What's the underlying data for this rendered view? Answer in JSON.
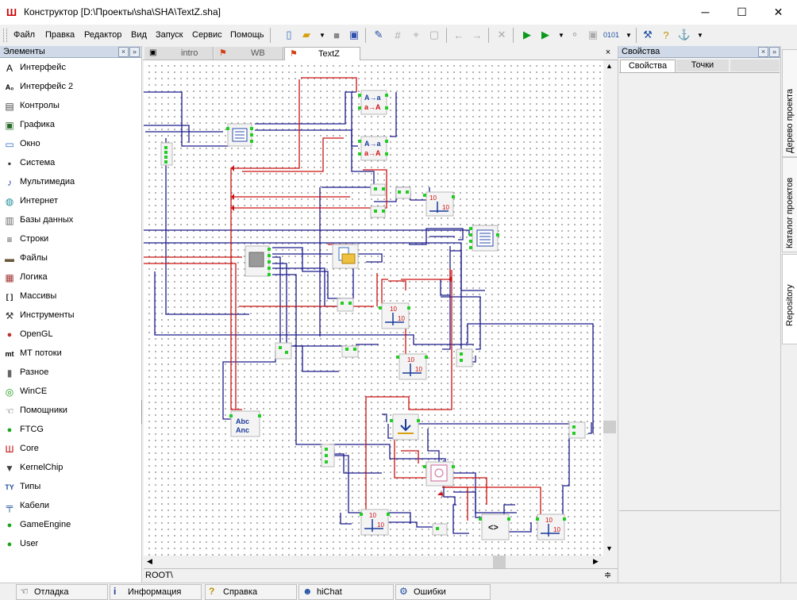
{
  "window": {
    "title": "Конструктор [D:\\Проекты\\sha\\SHA\\TextZ.sha]",
    "minimize_glyph": "─",
    "maximize_glyph": "☐",
    "close_glyph": "✕"
  },
  "menu": {
    "file": "Файл",
    "edit": "Правка",
    "editor": "Редактор",
    "view": "Вид",
    "run": "Запуск",
    "service": "Сервис",
    "help": "Помощь"
  },
  "elements_panel": {
    "title": "Элементы",
    "items": [
      {
        "label": "Интерфейс",
        "icon": "A"
      },
      {
        "label": "Интерфейс 2",
        "icon": "A₀"
      },
      {
        "label": "Контролы",
        "icon": "▤"
      },
      {
        "label": "Графика",
        "icon": "▣"
      },
      {
        "label": "Окно",
        "icon": "▭"
      },
      {
        "label": "Система",
        "icon": "▪"
      },
      {
        "label": "Мультимедиа",
        "icon": "♪"
      },
      {
        "label": "Интернет",
        "icon": "◍"
      },
      {
        "label": "Базы данных",
        "icon": "▥"
      },
      {
        "label": "Строки",
        "icon": "≡"
      },
      {
        "label": "Файлы",
        "icon": "▬"
      },
      {
        "label": "Логика",
        "icon": "▦"
      },
      {
        "label": "Массивы",
        "icon": "[ ]"
      },
      {
        "label": "Инструменты",
        "icon": "⚒"
      },
      {
        "label": "OpenGL",
        "icon": "●"
      },
      {
        "label": "МТ потоки",
        "icon": "mt"
      },
      {
        "label": "Разное",
        "icon": "▮"
      },
      {
        "label": "WinCE",
        "icon": "◎"
      },
      {
        "label": "Помощники",
        "icon": "☜"
      },
      {
        "label": "FTCG",
        "icon": "●"
      },
      {
        "label": "Core",
        "icon": "Ш"
      },
      {
        "label": "KernelChip",
        "icon": "▼"
      },
      {
        "label": "Типы",
        "icon": "TY"
      },
      {
        "label": "Кабели",
        "icon": "╤"
      },
      {
        "label": "GameEngine",
        "icon": "●"
      },
      {
        "label": "User",
        "icon": "●"
      }
    ]
  },
  "tabs": [
    {
      "label": "intro"
    },
    {
      "label": "WB"
    },
    {
      "label": "TextZ",
      "active": true
    }
  ],
  "canvas": {
    "nodes": [
      {
        "name": "node-case-convert-1",
        "lines": [
          "A→a",
          "a→A"
        ]
      },
      {
        "name": "node-case-convert-2",
        "lines": [
          "A→a",
          "a→A"
        ]
      },
      {
        "name": "node-memo-1",
        "lines": [
          ""
        ]
      },
      {
        "name": "node-memo-2",
        "lines": [
          ""
        ]
      },
      {
        "name": "node-button",
        "lines": [
          ""
        ]
      },
      {
        "name": "node-open-dialog",
        "lines": [
          ""
        ]
      },
      {
        "name": "node-math-1",
        "lines": [
          "10",
          "10"
        ]
      },
      {
        "name": "node-math-2",
        "lines": [
          "10",
          "10"
        ]
      },
      {
        "name": "node-math-3",
        "lines": [
          "10",
          "10"
        ]
      },
      {
        "name": "node-math-4",
        "lines": [
          "10",
          "10"
        ]
      },
      {
        "name": "node-math-5",
        "lines": [
          "10",
          "10"
        ]
      },
      {
        "name": "node-string-replace",
        "lines": [
          "Abc",
          "Anc"
        ]
      },
      {
        "name": "node-save",
        "lines": [
          ""
        ]
      },
      {
        "name": "node-loop",
        "lines": [
          ""
        ]
      },
      {
        "name": "node-compare",
        "lines": [
          "<>"
        ]
      }
    ],
    "path": "ROOT\\"
  },
  "properties_panel": {
    "title": "Свойства",
    "tabs": [
      "Свойства",
      "Точки"
    ]
  },
  "side_tabs": [
    "Дерево проекта",
    "Каталог проектов",
    "Repository"
  ],
  "statusbar": [
    {
      "label": "Отладка",
      "icon": "☜"
    },
    {
      "label": "Информация",
      "icon": "i"
    },
    {
      "label": "Справка",
      "icon": "?"
    },
    {
      "label": "hiChat",
      "icon": "☻"
    },
    {
      "label": "Ошибки",
      "icon": "⚙"
    }
  ],
  "colors": {
    "wire_blue": "#1a1a8c",
    "wire_red": "#cc1111",
    "pin_green": "#22cc22",
    "panel_header": "#cfd9e8"
  }
}
